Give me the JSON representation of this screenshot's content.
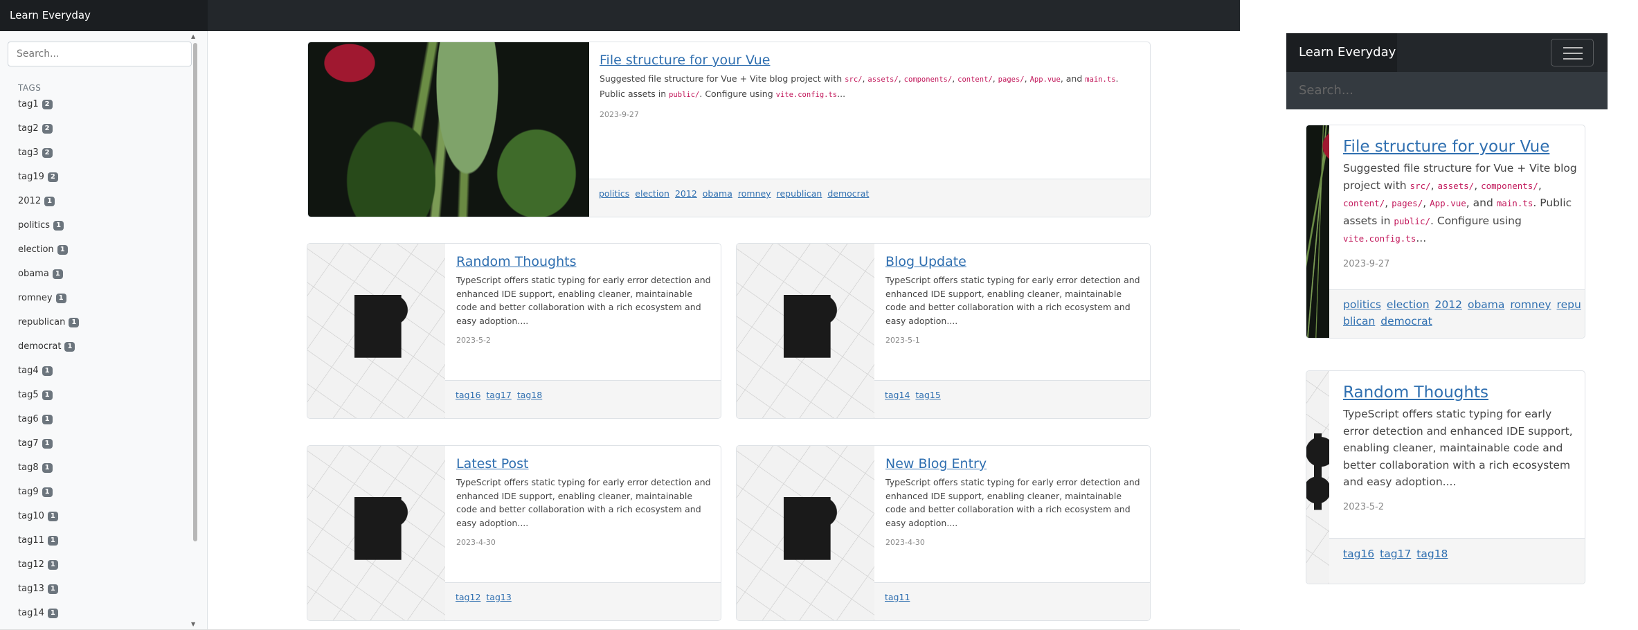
{
  "app": {
    "brand": "Learn Everyday"
  },
  "search": {
    "placeholder": "Search..."
  },
  "sidebar": {
    "heading": "TAGS",
    "tags": [
      {
        "name": "tag1",
        "count": "2"
      },
      {
        "name": "tag2",
        "count": "2"
      },
      {
        "name": "tag3",
        "count": "2"
      },
      {
        "name": "tag19",
        "count": "2"
      },
      {
        "name": "2012",
        "count": "1"
      },
      {
        "name": "politics",
        "count": "1"
      },
      {
        "name": "election",
        "count": "1"
      },
      {
        "name": "obama",
        "count": "1"
      },
      {
        "name": "romney",
        "count": "1"
      },
      {
        "name": "republican",
        "count": "1"
      },
      {
        "name": "democrat",
        "count": "1"
      },
      {
        "name": "tag4",
        "count": "1"
      },
      {
        "name": "tag5",
        "count": "1"
      },
      {
        "name": "tag6",
        "count": "1"
      },
      {
        "name": "tag7",
        "count": "1"
      },
      {
        "name": "tag8",
        "count": "1"
      },
      {
        "name": "tag9",
        "count": "1"
      },
      {
        "name": "tag10",
        "count": "1"
      },
      {
        "name": "tag11",
        "count": "1"
      },
      {
        "name": "tag12",
        "count": "1"
      },
      {
        "name": "tag13",
        "count": "1"
      },
      {
        "name": "tag14",
        "count": "1"
      }
    ]
  },
  "posts": [
    {
      "title": "File structure for your Vue",
      "excerpt": {
        "t1": "Suggested file structure for Vue + Vite blog project with ",
        "c1": "src/",
        "s1": ", ",
        "c2": "assets/",
        "s2": ", ",
        "c3": "components/",
        "s3": ", ",
        "c4": "content/",
        "s4": ", ",
        "c5": "pages/",
        "s5": ", ",
        "c6": "App.vue",
        "s6": ", and ",
        "c7": "main.ts",
        "t2": ". Public assets in ",
        "c8": "public/",
        "t3": ". Configure using ",
        "c9": "vite.config.ts",
        "t4": "..."
      },
      "date": "2023-9-27",
      "tags": [
        "politics",
        "election",
        "2012",
        "obama",
        "romney",
        "republican",
        "democrat"
      ]
    },
    {
      "title": "Random Thoughts",
      "excerpt": "TypeScript offers static typing for early error detection and enhanced IDE support, enabling cleaner, maintainable code and better collaboration with a rich ecosystem and easy adoption....",
      "date": "2023-5-2",
      "tags": [
        "tag16",
        "tag17",
        "tag18"
      ]
    },
    {
      "title": "Blog Update",
      "excerpt": "TypeScript offers static typing for early error detection and enhanced IDE support, enabling cleaner, maintainable code and better collaboration with a rich ecosystem and easy adoption....",
      "date": "2023-5-1",
      "tags": [
        "tag14",
        "tag15"
      ]
    },
    {
      "title": "Latest Post",
      "excerpt": "TypeScript offers static typing for early error detection and enhanced IDE support, enabling cleaner, maintainable code and better collaboration with a rich ecosystem and easy adoption....",
      "date": "2023-4-30",
      "tags": [
        "tag12",
        "tag13"
      ]
    },
    {
      "title": "New Blog Entry",
      "excerpt": "TypeScript offers static typing for early error detection and enhanced IDE support, enabling cleaner, maintainable code and better collaboration with a rich ecosystem and easy adoption....",
      "date": "2023-4-30",
      "tags": [
        "tag11"
      ]
    }
  ],
  "mobile_tags_post0_line1": [
    "politics",
    "election",
    "2012",
    "obama",
    "romney",
    "repu"
  ],
  "mobile_tags_post0_line2": [
    "blican",
    "democrat"
  ],
  "colors": {
    "navbar": "#23272b",
    "brand_bg": "#1b1e21",
    "link": "#2f6fb0",
    "code": "#c2185b",
    "badge": "#6c757d"
  },
  "icons": [
    "hamburger-menu-icon",
    "scroll-up-arrow-icon",
    "scroll-down-arrow-icon"
  ]
}
